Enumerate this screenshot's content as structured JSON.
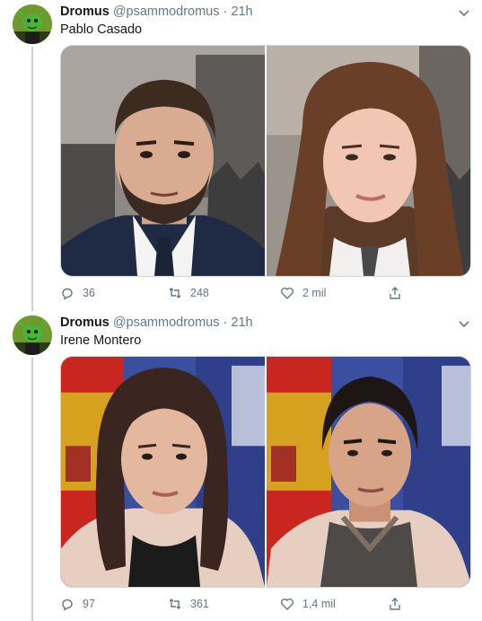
{
  "tweets": [
    {
      "display_name": "Dromus",
      "handle": "@psammodromus",
      "separator": "·",
      "time": "21h",
      "text": "Pablo Casado",
      "replies": "36",
      "retweets": "248",
      "likes": "2 mil"
    },
    {
      "display_name": "Dromus",
      "handle": "@psammodromus",
      "separator": "·",
      "time": "21h",
      "text": "Irene Montero",
      "replies": "97",
      "retweets": "361",
      "likes": "1,4 mil"
    }
  ],
  "icons": [
    "reply-icon",
    "retweet-icon",
    "like-icon",
    "share-icon",
    "chevron-down-icon"
  ],
  "colors": {
    "text": "#14171a",
    "secondary": "#657786",
    "thread_line": "#c8d2da",
    "border": "#ccd6dd"
  }
}
